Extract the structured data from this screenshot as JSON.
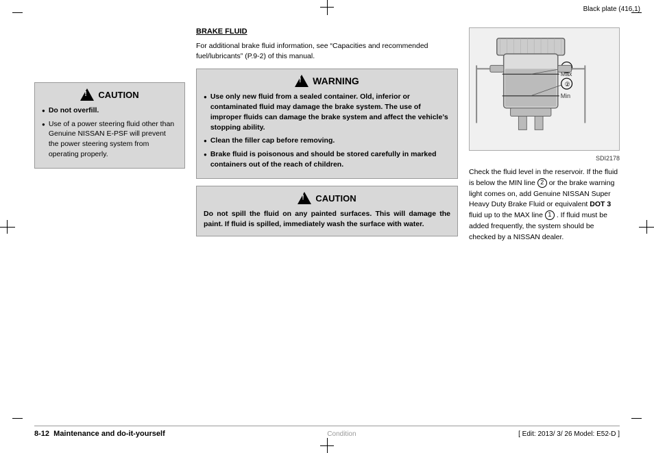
{
  "page": {
    "header_text": "Black plate (416,1)",
    "footer_page": "8-12",
    "footer_label": "Maintenance and do-it-yourself",
    "footer_condition": "Condition",
    "footer_edit": "[ Edit: 2013/ 3/ 26   Model: E52-D ]",
    "diagram_id": "SDI2178"
  },
  "left_column": {
    "caution_title": "CAUTION",
    "caution_bullets": [
      "Do not overfill.",
      "Use of a power steering fluid other than Genuine NISSAN E-PSF will prevent the power steering system from operating properly."
    ]
  },
  "middle_column": {
    "section_title": "BRAKE FLUID",
    "intro_text": "For additional brake fluid information, see \"Capacities and recommended fuel/lubricants\" (P.9-2) of this manual.",
    "warning_title": "WARNING",
    "warning_bullets": [
      "Use only new fluid from a sealed container. Old, inferior or contaminated fluid may damage the brake system. The use of improper fluids can damage the brake system and affect the vehicle's stopping ability.",
      "Clean the filler cap before removing.",
      "Brake fluid is poisonous and should be stored carefully in marked containers out of the reach of children."
    ],
    "caution2_title": "CAUTION",
    "caution2_text": "Do not spill the fluid on any painted surfaces. This will damage the paint. If fluid is spilled, immediately wash the surface with water."
  },
  "right_column": {
    "diagram_caption": "SDI2178",
    "description": "Check the fluid level in the reservoir. If the fluid is below the MIN line",
    "circle2": "2",
    "desc_mid": "or the brake warning light comes on, add Genuine NISSAN Super Heavy Duty Brake Fluid or equivalent",
    "dot3": "DOT 3",
    "desc_end": "fluid up to the MAX line",
    "circle1": "1",
    "desc_final": ". If fluid must be added frequently, the system should be checked by a NISSAN dealer.",
    "label_max": "Max",
    "label_min": "Min",
    "label_1": "①",
    "label_2": "②"
  }
}
